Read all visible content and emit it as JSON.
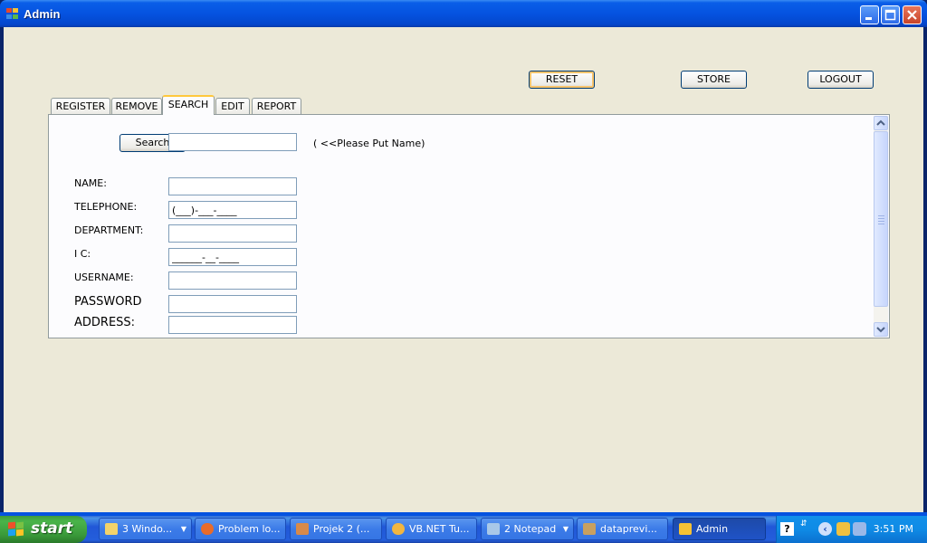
{
  "window": {
    "title": "Admin",
    "controls": [
      "minimize-icon",
      "maximize-icon",
      "close-icon"
    ]
  },
  "toolbar": {
    "reset_label": "RESET",
    "store_label": "STORE",
    "logout_label": "LOGOUT"
  },
  "tabs": [
    {
      "label": "REGISTER",
      "active": false
    },
    {
      "label": "REMOVE",
      "active": false
    },
    {
      "label": "SEARCH",
      "active": true
    },
    {
      "label": "EDIT",
      "active": false
    },
    {
      "label": "REPORT",
      "active": false
    }
  ],
  "search": {
    "button_label": "Search",
    "value": "",
    "hint": "( <<Please Put Name)"
  },
  "form": {
    "fields": [
      {
        "label": "NAME:",
        "value": ""
      },
      {
        "label": "TELEPHONE:",
        "value": "(___)-___-____"
      },
      {
        "label": "DEPARTMENT:",
        "value": ""
      },
      {
        "label": "I C:",
        "value": "______-__-____"
      },
      {
        "label": "USERNAME:",
        "value": ""
      },
      {
        "label": "PASSWORD",
        "value": ""
      },
      {
        "label": "ADDRESS:",
        "value": ""
      }
    ]
  },
  "taskbar": {
    "start_label": "start",
    "tasks": [
      {
        "label": "3 Windo...",
        "icon": "folder-icon",
        "group": true
      },
      {
        "label": "Problem lo...",
        "icon": "firefox-icon",
        "group": false
      },
      {
        "label": "Projek 2 (...",
        "icon": "visual-studio-icon",
        "group": false
      },
      {
        "label": "VB.NET Tu...",
        "icon": "browser-icon",
        "group": false
      },
      {
        "label": "2 Notepad",
        "icon": "notepad-icon",
        "group": true
      },
      {
        "label": "dataprevi...",
        "icon": "app-icon",
        "group": false
      },
      {
        "label": "Admin",
        "icon": "form-icon",
        "group": false
      }
    ],
    "clock": "3:51 PM"
  },
  "colors": {
    "titlebar": "#0553e0",
    "client": "#ece9d8",
    "taskbar": "#245edb",
    "start": "#3a9a3a",
    "default_button_ring": "#f8c46c"
  }
}
